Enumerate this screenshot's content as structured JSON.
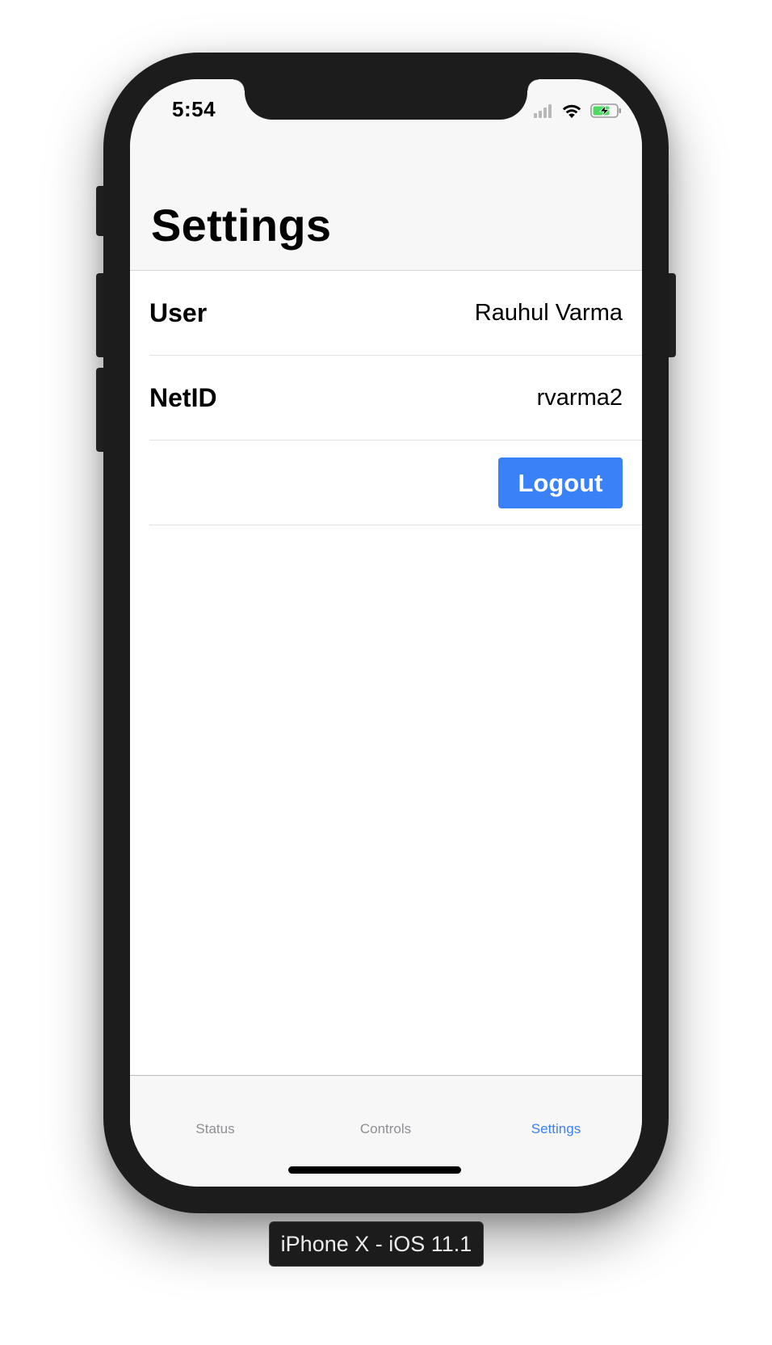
{
  "status_bar": {
    "time": "5:54",
    "icons": [
      "signal-icon",
      "wifi-icon",
      "battery-charging-icon"
    ]
  },
  "nav": {
    "title": "Settings"
  },
  "rows": [
    {
      "label": "User",
      "value": "Rauhul Varma"
    },
    {
      "label": "NetID",
      "value": "rvarma2"
    }
  ],
  "logout_button": {
    "label": "Logout"
  },
  "tab_bar": {
    "tabs": [
      {
        "label": "Status",
        "active": false
      },
      {
        "label": "Controls",
        "active": false
      },
      {
        "label": "Settings",
        "active": true
      }
    ]
  },
  "device_label": "iPhone X - iOS 11.1",
  "colors": {
    "accent": "#3a80f6",
    "frame": "#1c1c1c",
    "tab_inactive": "#8e8e93",
    "battery_fill": "#4cd964"
  }
}
